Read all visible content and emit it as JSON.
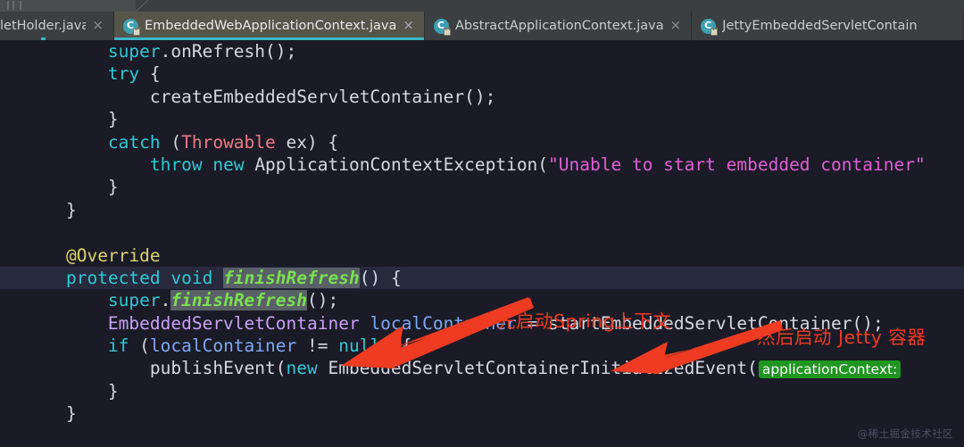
{
  "window": {
    "breadcrumb_strip_visible": true
  },
  "tabs": [
    {
      "label": "letHolder.java",
      "clipped": true,
      "active": false,
      "icon": "java-class-locked-icon",
      "close_glyph": "×",
      "modified_dot": true
    },
    {
      "label": "EmbeddedWebApplicationContext.java",
      "clipped": false,
      "active": true,
      "icon": "java-class-locked-icon",
      "close_glyph": "×",
      "modified_dot": false
    },
    {
      "label": "AbstractApplicationContext.java",
      "clipped": false,
      "active": false,
      "icon": "java-class-locked-icon",
      "close_glyph": "×",
      "modified_dot": false
    },
    {
      "label": "JettyEmbeddedServletContain",
      "clipped": true,
      "active": false,
      "icon": "java-class-locked-icon",
      "close_glyph": "",
      "modified_dot": false
    }
  ],
  "code": {
    "language": "java",
    "lines": [
      {
        "indent": 2,
        "tokens": [
          {
            "t": "super",
            "c": "kw"
          },
          {
            "t": ".onRefresh();",
            "c": "plain"
          }
        ]
      },
      {
        "indent": 2,
        "tokens": [
          {
            "t": "try",
            "c": "kw"
          },
          {
            "t": " {",
            "c": "plain"
          }
        ]
      },
      {
        "indent": 3,
        "tokens": [
          {
            "t": "createEmbeddedServletContainer();",
            "c": "plain"
          }
        ]
      },
      {
        "indent": 2,
        "tokens": [
          {
            "t": "}",
            "c": "plain"
          }
        ]
      },
      {
        "indent": 2,
        "tokens": [
          {
            "t": "catch",
            "c": "kw"
          },
          {
            "t": " (",
            "c": "plain"
          },
          {
            "t": "Throwable",
            "c": "type"
          },
          {
            "t": " ex) {",
            "c": "plain"
          }
        ]
      },
      {
        "indent": 3,
        "tokens": [
          {
            "t": "throw",
            "c": "kw"
          },
          {
            "t": " ",
            "c": "plain"
          },
          {
            "t": "new",
            "c": "kw"
          },
          {
            "t": " ApplicationContextException(",
            "c": "plain"
          },
          {
            "t": "\"Unable to start embedded container\"",
            "c": "str"
          }
        ]
      },
      {
        "indent": 2,
        "tokens": [
          {
            "t": "}",
            "c": "plain"
          }
        ]
      },
      {
        "indent": 1,
        "tokens": [
          {
            "t": "}",
            "c": "plain"
          }
        ]
      },
      {
        "indent": 0,
        "tokens": []
      },
      {
        "indent": 1,
        "tokens": [
          {
            "t": "@Override",
            "c": "ann"
          }
        ]
      },
      {
        "indent": 1,
        "highlight": true,
        "tokens": [
          {
            "t": "protected",
            "c": "kw"
          },
          {
            "t": " ",
            "c": "plain"
          },
          {
            "t": "void",
            "c": "kw"
          },
          {
            "t": " ",
            "c": "plain"
          },
          {
            "t": "finishRefresh",
            "c": "mname"
          },
          {
            "t": "() {",
            "c": "plain"
          }
        ]
      },
      {
        "indent": 2,
        "tokens": [
          {
            "t": "super",
            "c": "kw"
          },
          {
            "t": ".",
            "c": "plain"
          },
          {
            "t": "finishRefresh",
            "c": "mname"
          },
          {
            "t": "();",
            "c": "plain"
          }
        ]
      },
      {
        "indent": 2,
        "tokens": [
          {
            "t": "EmbeddedServletContainer",
            "c": "cls"
          },
          {
            "t": " ",
            "c": "plain"
          },
          {
            "t": "localContainer",
            "c": "var"
          },
          {
            "t": " = startEmbeddedServletContainer();",
            "c": "plain"
          }
        ]
      },
      {
        "indent": 2,
        "tokens": [
          {
            "t": "if",
            "c": "kw"
          },
          {
            "t": " (",
            "c": "plain"
          },
          {
            "t": "localContainer",
            "c": "var"
          },
          {
            "t": " != ",
            "c": "plain"
          },
          {
            "t": "null",
            "c": "kwnull"
          },
          {
            "t": ") {",
            "c": "plain"
          }
        ]
      },
      {
        "indent": 3,
        "tokens": [
          {
            "t": "publishEvent(",
            "c": "plain"
          },
          {
            "t": "new",
            "c": "kw"
          },
          {
            "t": " EmbeddedServletContainerInitializedEvent(",
            "c": "plain"
          },
          {
            "t": "applicationContext:",
            "c": "hint"
          }
        ]
      },
      {
        "indent": 2,
        "tokens": [
          {
            "t": "}",
            "c": "plain"
          }
        ]
      },
      {
        "indent": 1,
        "tokens": [
          {
            "t": "}",
            "c": "plain"
          }
        ]
      }
    ]
  },
  "annotations": [
    {
      "id": "anno1",
      "text": "先启动Spring上下文",
      "color": "#ee3b22"
    },
    {
      "id": "anno2",
      "text": "然后启动 Jetty 容器",
      "color": "#ee3b22"
    }
  ],
  "arrows": [
    {
      "id": "arrow1",
      "points_to": "super.finishRefresh();",
      "color": "#ee3b22",
      "direction": "down-left"
    },
    {
      "id": "arrow2",
      "points_to": "startEmbeddedServletContainer();",
      "color": "#ee3b22",
      "direction": "down-left"
    }
  ],
  "watermark": {
    "text": "@稀土掘金技术社区"
  },
  "theme": {
    "editor_bg": "#1a1b26",
    "tabbar_bg": "#3c3f41",
    "active_tab_bg": "#56554a",
    "active_tab_underline": "#3bb6c8",
    "keyword": "#2fc8d4",
    "string": "#e05fd8",
    "class_name": "#c9a0f5",
    "local_var": "#7fa7f7",
    "annotation": "#ddd36a",
    "method_name": "#79e04f",
    "inlay_hint_bg": "#1f9620",
    "line_highlight": "#272a3d"
  }
}
